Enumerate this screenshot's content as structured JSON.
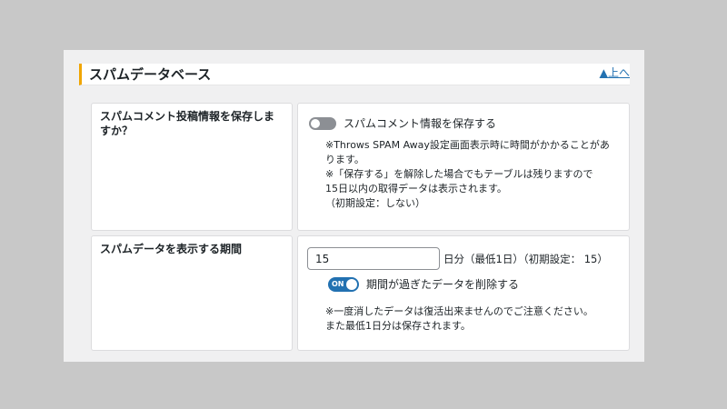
{
  "section": {
    "title": "スパムデータベース",
    "top_link": "▲上へ"
  },
  "rows": [
    {
      "label": "スパムコメント投稿情報を保存しますか？",
      "toggle": {
        "state": "off",
        "label": "スパムコメント情報を保存する"
      },
      "notes": [
        "※Throws SPAM Away設定画面表示時に時間がかかることがあ",
        "ります。",
        "※「保存する」を解除した場合でもテーブルは残りますので",
        "15日以内の取得データは表示されます。",
        "（初期設定：しない）"
      ]
    },
    {
      "label": "スパムデータを表示する期間",
      "input_value": "15",
      "input_suffix": "日分（最低1日）（初期設定： 15）",
      "toggle": {
        "state": "on",
        "on_text": "ON",
        "label": "期間が過ぎたデータを削除する"
      },
      "notes": [
        "※一度消したデータは復活出来ませんのでご注意ください。",
        "また最低1日分は保存されます。"
      ]
    }
  ],
  "colors": {
    "accent": "#f0a500",
    "toggle_on": "#2271b1",
    "toggle_off": "#8c8f94",
    "link": "#2271b1"
  }
}
